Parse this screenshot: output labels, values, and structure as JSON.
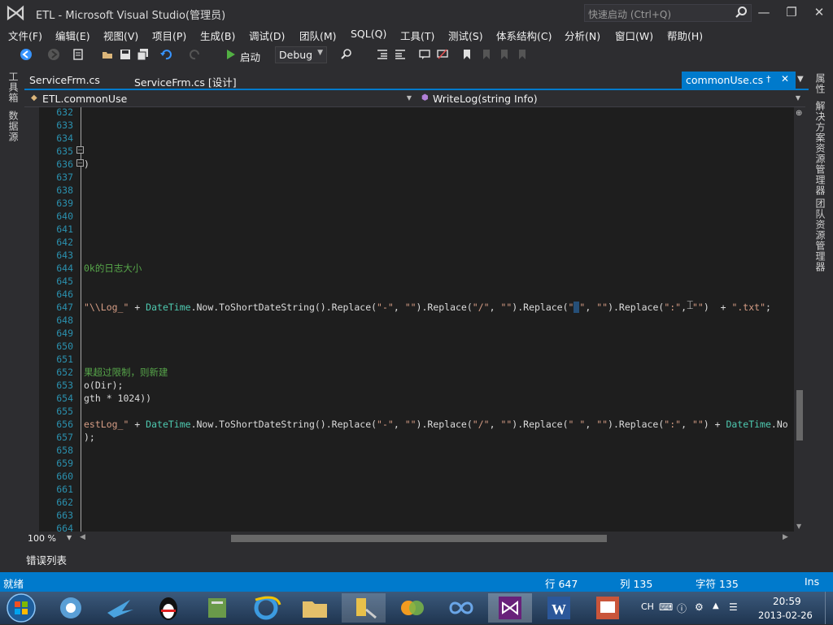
{
  "window": {
    "title": "ETL - Microsoft Visual Studio(管理员)",
    "quick_launch_placeholder": "快速启动 (Ctrl+Q)"
  },
  "menu": [
    "文件(F)",
    "编辑(E)",
    "视图(V)",
    "项目(P)",
    "生成(B)",
    "调试(D)",
    "团队(M)",
    "SQL(Q)",
    "工具(T)",
    "测试(S)",
    "体系结构(C)",
    "分析(N)",
    "窗口(W)",
    "帮助(H)"
  ],
  "toolbar": {
    "start_label": "启动",
    "config_value": "Debug"
  },
  "left_tool_windows": [
    "工具箱",
    "数据源"
  ],
  "right_tool_windows": [
    "属性",
    "解决方案资源管理器",
    "团队资源管理器"
  ],
  "tabs": {
    "items": [
      "ServiceFrm.cs",
      "ServiceFrm.cs [设计]"
    ],
    "active": "commonUse.cs"
  },
  "nav": {
    "type": "ETL.commonUse",
    "member": "WriteLog(string Info)"
  },
  "editor": {
    "line_numbers": [
      "632",
      "633",
      "634",
      "635",
      "636",
      "637",
      "638",
      "639",
      "640",
      "641",
      "642",
      "643",
      "644",
      "645",
      "646",
      "647",
      "648",
      "649",
      "650",
      "651",
      "652",
      "653",
      "654",
      "655",
      "656",
      "657",
      "658",
      "659",
      "660",
      "661",
      "662",
      "663",
      "664"
    ],
    "line_636_text": ")",
    "line_644_text": "0k的日志大小",
    "line_652_text": "果超过限制，则新建",
    "line_653_text": "o(Dir);",
    "line_654_text": "gth * 1024))",
    "line_657_text": ");"
  },
  "editor_footer": {
    "zoom": "100 %"
  },
  "error_list_label": "错误列表",
  "status": {
    "ready": "就绪",
    "line": "行 647",
    "col": "列 135",
    "char": "字符 135",
    "mode": "Ins"
  },
  "tray": {
    "lang": "CH",
    "time": "20:59",
    "date": "2013-02-26"
  },
  "colors": {
    "accent": "#007acc",
    "editor_bg": "#1e1e1e",
    "chrome_bg": "#2d2d30"
  }
}
